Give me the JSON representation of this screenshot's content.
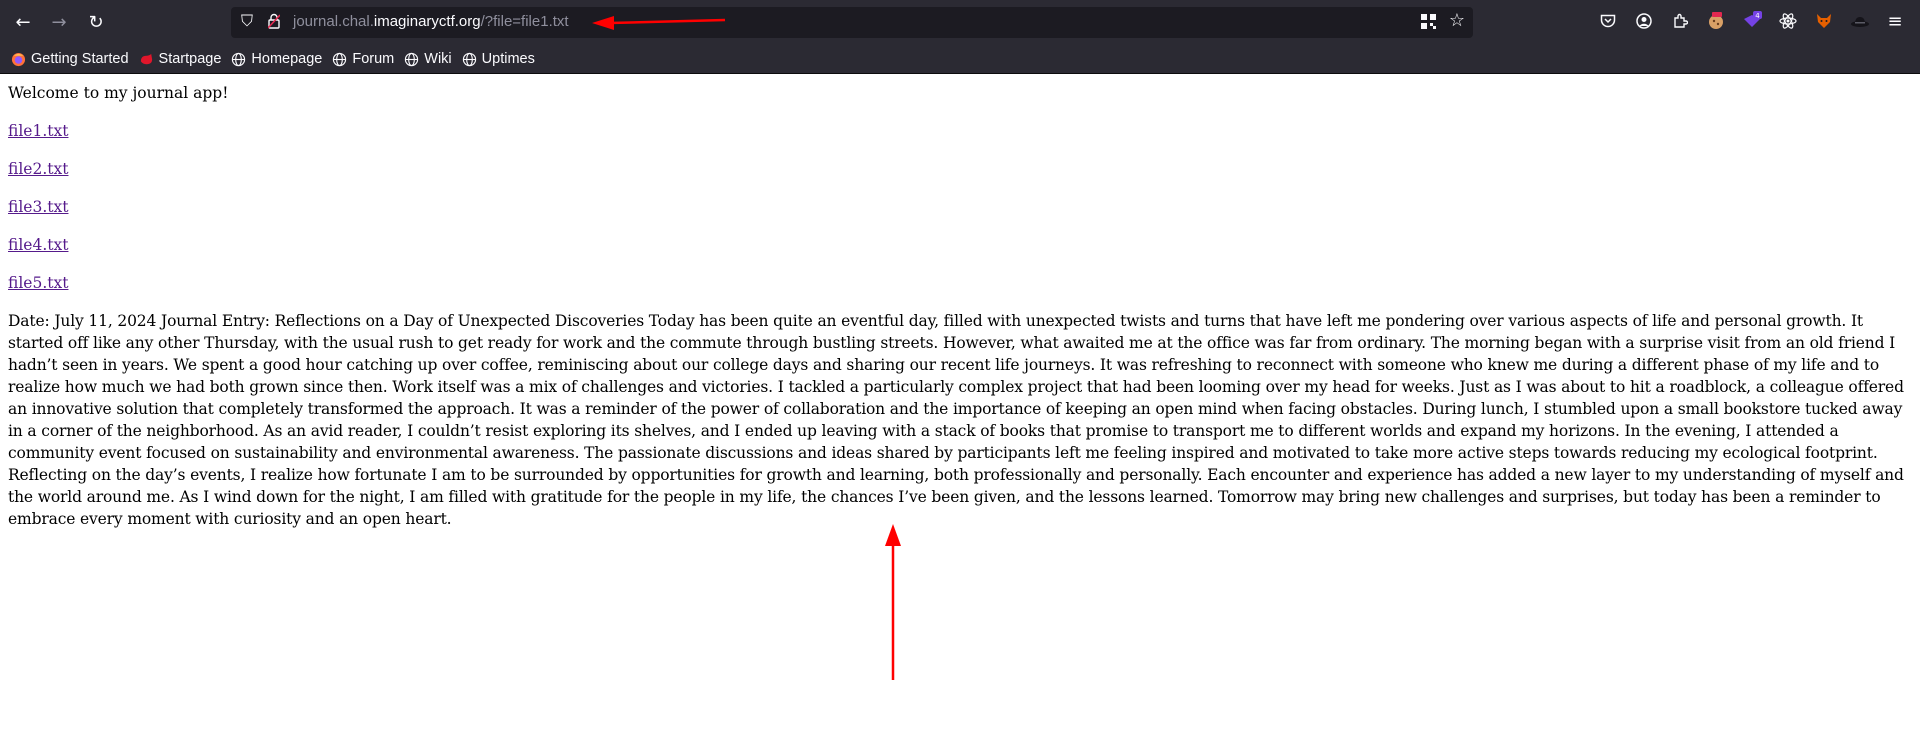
{
  "browser": {
    "url_prefix": "journal.chal.",
    "url_host": "imaginaryctf.org",
    "url_path": "/?file=file1.txt",
    "icons": [
      "back-icon",
      "forward-icon",
      "reload-icon",
      "shield-icon",
      "lock-icon",
      "qr-icon",
      "bookmark-star-icon",
      "pocket-icon",
      "account-icon",
      "extensions-icon",
      "menu-icon"
    ]
  },
  "bookmarks": [
    {
      "label": "Getting Started"
    },
    {
      "label": "Startpage"
    },
    {
      "label": "Homepage"
    },
    {
      "label": "Forum"
    },
    {
      "label": "Wiki"
    },
    {
      "label": "Uptimes"
    }
  ],
  "page": {
    "welcome": "Welcome to my journal app!",
    "files": [
      "file1.txt",
      "file2.txt",
      "file3.txt",
      "file4.txt",
      "file5.txt"
    ],
    "journal_text": "Date: July 11, 2024 Journal Entry: Reflections on a Day of Unexpected Discoveries Today has been quite an eventful day, filled with unexpected twists and turns that have left me pondering over various aspects of life and personal growth. It started off like any other Thursday, with the usual rush to get ready for work and the commute through bustling streets. However, what awaited me at the office was far from ordinary. The morning began with a surprise visit from an old friend I hadn’t seen in years. We spent a good hour catching up over coffee, reminiscing about our college days and sharing our recent life journeys. It was refreshing to reconnect with someone who knew me during a different phase of my life and to realize how much we had both grown since then. Work itself was a mix of challenges and victories. I tackled a particularly complex project that had been looming over my head for weeks. Just as I was about to hit a roadblock, a colleague offered an innovative solution that completely transformed the approach. It was a reminder of the power of collaboration and the importance of keeping an open mind when facing obstacles. During lunch, I stumbled upon a small bookstore tucked away in a corner of the neighborhood. As an avid reader, I couldn’t resist exploring its shelves, and I ended up leaving with a stack of books that promise to transport me to different worlds and expand my horizons. In the evening, I attended a community event focused on sustainability and environmental awareness. The passionate discussions and ideas shared by participants left me feeling inspired and motivated to take more active steps towards reducing my ecological footprint. Reflecting on the day’s events, I realize how fortunate I am to be surrounded by opportunities for growth and learning, both professionally and personally. Each encounter and experience has added a new layer to my understanding of myself and the world around me. As I wind down for the night, I am filled with gratitude for the people in my life, the chances I’ve been given, and the lessons learned. Tomorrow may bring new challenges and surprises, but today has been a reminder to embrace every moment with curiosity and an open heart."
  },
  "colors": {
    "chrome": "#2b2a33",
    "urlbar": "#1c1b22",
    "link": "#551a8b",
    "annotation": "#ff0000"
  }
}
